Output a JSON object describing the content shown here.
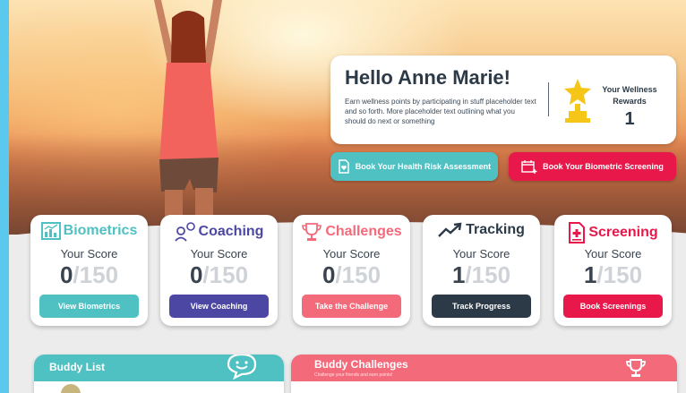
{
  "welcome": {
    "title": "Hello Anne Marie!",
    "description": "Earn wellness points by participating in stuff placeholder text and so forth. More placeholder text outlining what you should do next or something",
    "rewards_label": "Your Wellness Rewards",
    "rewards_value": "1"
  },
  "actions": {
    "hra_label": "Book Your Health Risk Assessment",
    "biometric_label": "Book Your Biometric Screening"
  },
  "cards": [
    {
      "title": "Biometrics",
      "label": "Your Score",
      "score": "0",
      "sep": "/",
      "max": "150",
      "button": "View Biometrics",
      "color": "#4fc1c3"
    },
    {
      "title": "Coaching",
      "label": "Your Score",
      "score": "0",
      "sep": "/",
      "max": "150",
      "button": "View Coaching",
      "color": "#4d47a4"
    },
    {
      "title": "Challenges",
      "label": "Your Score",
      "score": "0",
      "sep": "/",
      "max": "150",
      "button": "Take the Challenge",
      "color": "#f36a7a"
    },
    {
      "title": "Tracking",
      "label": "Your Score",
      "score": "1",
      "sep": "/",
      "max": "150",
      "button": "Track Progress",
      "color": "#2c3a48"
    },
    {
      "title": "Screening",
      "label": "Your Score",
      "score": "1",
      "sep": "/",
      "max": "150",
      "button": "Book Screenings",
      "color": "#e8184a"
    }
  ],
  "buddy_list": {
    "title": "Buddy List"
  },
  "buddy_challenges": {
    "title": "Buddy Challenges",
    "subtitle": "Challenge your friends and earn points!"
  }
}
